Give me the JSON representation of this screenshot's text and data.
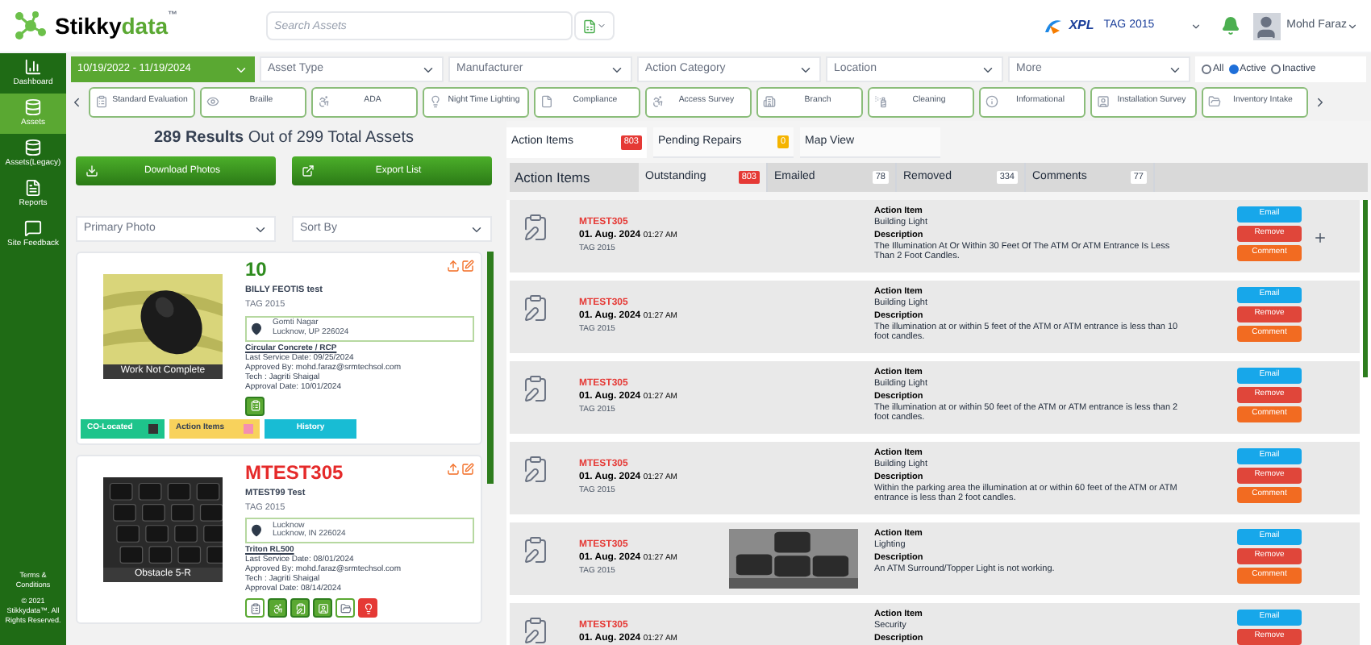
{
  "header": {
    "logo": {
      "first": "Stikky",
      "second": "data",
      "mark": "™"
    },
    "search": {
      "placeholder": "Search Assets"
    },
    "org_logo": "XPL",
    "org_select": "TAG 2015",
    "user": "Mohd Faraz"
  },
  "sidebar": {
    "items": [
      {
        "label": "Dashboard",
        "selected": false
      },
      {
        "label": "Assets",
        "selected": true
      },
      {
        "label": "Assets(Legacy)",
        "selected": false
      },
      {
        "label": "Reports",
        "selected": false
      },
      {
        "label": "Site Feedback",
        "selected": false
      }
    ],
    "footer": [
      "Terms & Conditions",
      "© 2021 Stikkydata™. All Rights Reserved."
    ]
  },
  "filters": {
    "date_range": "10/19/2022 - 11/19/2024",
    "selects": [
      "Asset Type",
      "Manufacturer",
      "Action Category",
      "Location",
      "More"
    ],
    "status": [
      {
        "label": "All",
        "selected": false
      },
      {
        "label": "Active",
        "selected": true
      },
      {
        "label": "Inactive",
        "selected": false
      }
    ]
  },
  "categories": [
    "Standard Evaluation",
    "Braille",
    "ADA",
    "Night Time Lighting",
    "Compliance",
    "Access Survey",
    "Branch",
    "Cleaning",
    "Informational",
    "Installation Survey",
    "Inventory Intake"
  ],
  "assets_panel": {
    "count": "289 Results",
    "total": "Out of 299 Total Assets",
    "buttons": [
      "Download Photos",
      "Export List"
    ],
    "selects": [
      "Primary Photo",
      "Sort By"
    ],
    "cards": [
      {
        "number": "10",
        "alert": false,
        "name": "BILLY FEOTIS test",
        "tag": "TAG 2015",
        "address1": "Gomti Nagar",
        "address2": "Lucknow, UP 226024",
        "model": "Circular Concrete / RCP",
        "service": "Last Service Date: 09/25/2024",
        "approved": "Approved By: mohd.faraz@srmtechsol.com",
        "tech": "Tech : Jagriti Shaigal",
        "approval": "Approval Date: 10/01/2024",
        "photo_caption": "Work Not Complete",
        "kind": "summary",
        "badges": [
          "CO-Located",
          "Action Items",
          "History"
        ]
      },
      {
        "number": "MTEST305",
        "alert": true,
        "name": "MTEST99 Test",
        "tag": "TAG 2015",
        "address1": "Lucknow",
        "address2": "Lucknow, IN 226024",
        "model": "Triton RL500",
        "service": "Last Service Date: 08/01/2024",
        "approved": "Approved By: mohd.faraz@srmtechsol.com",
        "tech": "Tech : Jagriti Shaigal",
        "approval": "Approval Date: 08/14/2024",
        "photo_caption": "Obstacle 5-R",
        "kind": "detailed"
      }
    ]
  },
  "action_panel": {
    "tabs": [
      {
        "label": "Action Items",
        "count": "803",
        "selected": true,
        "color": "#e53935"
      },
      {
        "label": "Pending Repairs",
        "count": "0",
        "selected": false,
        "color": "#f5b400"
      },
      {
        "label": "Map View",
        "selected": false
      }
    ],
    "title": "Action Items",
    "subtabs": [
      {
        "label": "Outstanding",
        "count": "803",
        "selected": true
      },
      {
        "label": "Emailed",
        "count": "78",
        "selected": false
      },
      {
        "label": "Removed",
        "count": "334",
        "selected": false
      },
      {
        "label": "Comments",
        "count": "77",
        "selected": false
      }
    ],
    "rows": [
      {
        "id": "MTEST305",
        "date": "01. Aug. 2024",
        "time": "01:27 AM",
        "tag": "TAG 2015",
        "photo": false,
        "expandable": true,
        "item_label": "Action Item",
        "item": "Building Light",
        "desc_label": "Description",
        "description": "The Illumination At Or Within 30 Feet Of The ATM Or ATM Entrance Is Less Than 2 Foot Candles.",
        "buttons": [
          "Email",
          "Remove",
          "Comment"
        ]
      },
      {
        "id": "MTEST305",
        "date": "01. Aug. 2024",
        "time": "01:27 AM",
        "tag": "TAG 2015",
        "photo": false,
        "expandable": false,
        "item_label": "Action Item",
        "item": "Building Light",
        "desc_label": "Description",
        "description": "The illumination at or within 5 feet of the ATM or ATM entrance is less than 10 foot candles.",
        "buttons": [
          "Email",
          "Remove",
          "Comment"
        ]
      },
      {
        "id": "MTEST305",
        "date": "01. Aug. 2024",
        "time": "01:27 AM",
        "tag": "TAG 2015",
        "photo": false,
        "expandable": false,
        "item_label": "Action Item",
        "item": "Building Light",
        "desc_label": "Description",
        "description": "The illumination at or within 50 feet of the ATM or ATM entrance is less than 2 foot candles.",
        "buttons": [
          "Email",
          "Remove",
          "Comment"
        ]
      },
      {
        "id": "MTEST305",
        "date": "01. Aug. 2024",
        "time": "01:27 AM",
        "tag": "TAG 2015",
        "photo": false,
        "expandable": false,
        "item_label": "Action Item",
        "item": "Building Light",
        "desc_label": "Description",
        "description": "Within the parking area the illumination at or within 60 feet of the ATM or ATM entrance is less than 2 foot candles.",
        "buttons": [
          "Email",
          "Remove",
          "Comment"
        ]
      },
      {
        "id": "MTEST305",
        "date": "01. Aug. 2024",
        "time": "01:27 AM",
        "tag": "TAG 2015",
        "photo": true,
        "expandable": false,
        "item_label": "Action Item",
        "item": "Lighting",
        "desc_label": "Description",
        "description": "An ATM Surround/Topper Light is not working.",
        "buttons": [
          "Email",
          "Remove",
          "Comment"
        ]
      },
      {
        "id": "MTEST305",
        "date": "01. Aug. 2024",
        "time": "01:27 AM",
        "photo": false,
        "expandable": false,
        "item_label": "Action Item",
        "item": "Security",
        "desc_label": "Description",
        "buttons": [
          "Email",
          "Remove"
        ]
      }
    ]
  }
}
